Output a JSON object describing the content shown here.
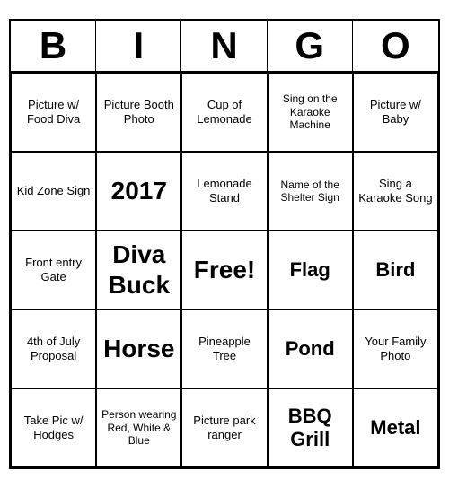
{
  "header": {
    "letters": [
      "B",
      "I",
      "N",
      "G",
      "O"
    ]
  },
  "cells": [
    {
      "text": "Picture w/ Food Diva",
      "size": "normal"
    },
    {
      "text": "Picture Booth Photo",
      "size": "normal"
    },
    {
      "text": "Cup of Lemonade",
      "size": "normal"
    },
    {
      "text": "Sing on the Karaoke Machine",
      "size": "small"
    },
    {
      "text": "Picture w/ Baby",
      "size": "normal"
    },
    {
      "text": "Kid Zone Sign",
      "size": "normal"
    },
    {
      "text": "2017",
      "size": "large"
    },
    {
      "text": "Lemonade Stand",
      "size": "normal"
    },
    {
      "text": "Name of the Shelter Sign",
      "size": "small"
    },
    {
      "text": "Sing a Karaoke Song",
      "size": "normal"
    },
    {
      "text": "Front entry Gate",
      "size": "normal"
    },
    {
      "text": "Diva Buck",
      "size": "large"
    },
    {
      "text": "Free!",
      "size": "free"
    },
    {
      "text": "Flag",
      "size": "medium"
    },
    {
      "text": "Bird",
      "size": "medium"
    },
    {
      "text": "4th of July Proposal",
      "size": "normal"
    },
    {
      "text": "Horse",
      "size": "large"
    },
    {
      "text": "Pineapple Tree",
      "size": "normal"
    },
    {
      "text": "Pond",
      "size": "medium"
    },
    {
      "text": "Your Family Photo",
      "size": "normal"
    },
    {
      "text": "Take Pic w/ Hodges",
      "size": "normal"
    },
    {
      "text": "Person wearing Red, White & Blue",
      "size": "small"
    },
    {
      "text": "Picture park ranger",
      "size": "normal"
    },
    {
      "text": "BBQ Grill",
      "size": "medium"
    },
    {
      "text": "Metal",
      "size": "medium"
    }
  ]
}
